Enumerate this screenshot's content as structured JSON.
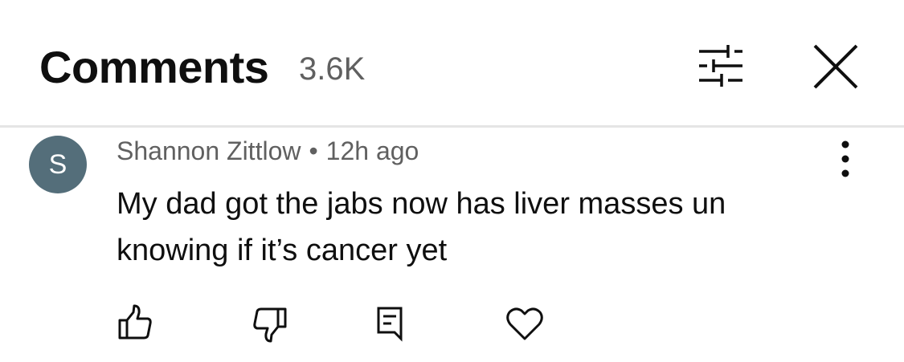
{
  "header": {
    "title": "Comments",
    "count": "3.6K",
    "filter_icon": "sort-filter-icon",
    "close_icon": "close-icon"
  },
  "comment": {
    "avatar_letter": "S",
    "avatar_color": "#546e7a",
    "author": "Shannon Zittlow",
    "separator": "•",
    "time": "12h ago",
    "text": "My dad got the jabs now has liver masses un knowing if it’s cancer yet",
    "more_icon": "more-vertical-icon",
    "actions": {
      "like_icon": "thumbs-up-icon",
      "dislike_icon": "thumbs-down-icon",
      "reply_icon": "reply-comment-icon",
      "heart_icon": "heart-icon"
    }
  },
  "colors": {
    "text_primary": "#0f0f0f",
    "text_secondary": "#606060",
    "divider": "#e5e5e5",
    "background": "#ffffff"
  }
}
